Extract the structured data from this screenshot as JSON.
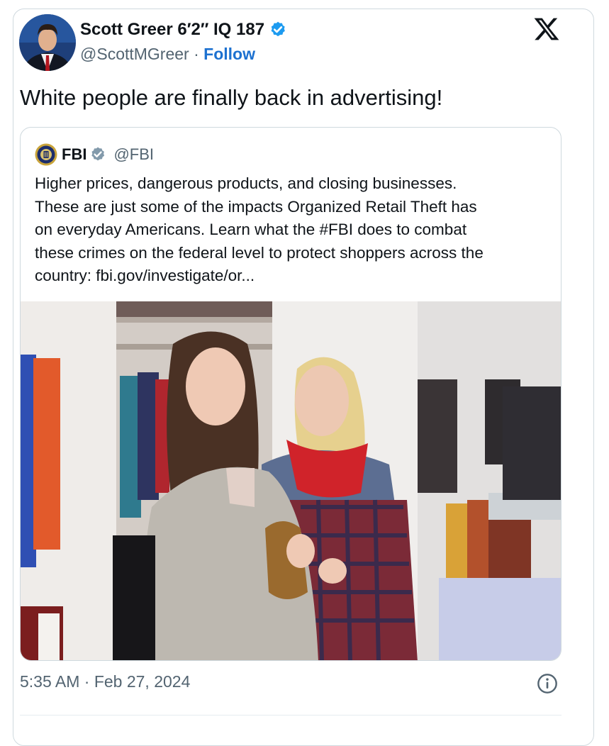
{
  "tweet": {
    "author": {
      "display_name": "Scott Greer 6′2″ IQ 187",
      "handle": "@ScottMGreer",
      "separator": "·",
      "follow_label": "Follow",
      "verified_icon": "verified-badge-icon",
      "avatar_icon": "avatar"
    },
    "platform_icon": "x-logo-icon",
    "text": "White people are finally back in advertising!",
    "timestamp": "5:35 AM · Feb 27, 2024",
    "info_icon": "info-icon"
  },
  "quoted_tweet": {
    "author": {
      "display_name": "FBI",
      "handle": "@FBI",
      "verified_icon": "gray-verified-badge-icon",
      "avatar_icon": "fbi-seal-icon"
    },
    "text_lines": [
      "Higher prices, dangerous products, and closing businesses.",
      "These are just some of the impacts Organized Retail Theft has",
      "on everyday Americans. Learn what the #FBI does to combat",
      "these crimes on the federal level to protect shoppers across the",
      "country: fbi.gov/investigate/or..."
    ],
    "media": "photo of two women in a clothing store, one concealing a handbag"
  },
  "colors": {
    "link_blue": "#1d71d0",
    "verified_blue": "#1d9bf0",
    "verified_gray": "#829aab",
    "secondary_text": "#536471",
    "border": "#cfd9de"
  }
}
